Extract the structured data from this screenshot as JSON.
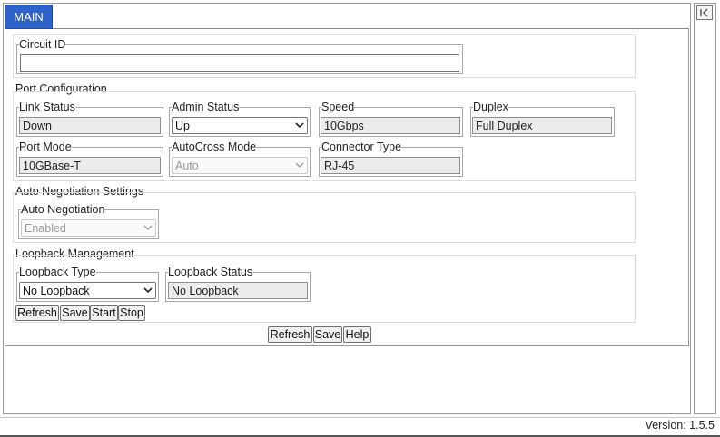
{
  "tabs": [
    {
      "label": "MAIN",
      "active": true
    }
  ],
  "collapse_icon": "collapse-left-icon",
  "circuit": {
    "legend": "Circuit ID",
    "value": "",
    "placeholder": ""
  },
  "port_config": {
    "title": "Port Configuration",
    "link_status": {
      "label": "Link Status",
      "value": "Down"
    },
    "admin_status": {
      "label": "Admin Status",
      "value": "Up"
    },
    "speed": {
      "label": "Speed",
      "value": "10Gbps"
    },
    "duplex": {
      "label": "Duplex",
      "value": "Full Duplex"
    },
    "port_mode": {
      "label": "Port Mode",
      "value": "10GBase-T"
    },
    "autocross": {
      "label": "AutoCross Mode",
      "value": "Auto",
      "disabled": true
    },
    "connector": {
      "label": "Connector Type",
      "value": "RJ-45"
    }
  },
  "auto_neg": {
    "title": "Auto Negotiation Settings",
    "field": {
      "label": "Auto Negotiation",
      "value": "Enabled",
      "disabled": true
    }
  },
  "loopback": {
    "title": "Loopback Management",
    "type": {
      "label": "Loopback Type",
      "value": "No Loopback"
    },
    "status": {
      "label": "Loopback Status",
      "value": "No Loopback"
    },
    "buttons": {
      "refresh": "Refresh",
      "save": "Save",
      "start": "Start",
      "stop": "Stop"
    }
  },
  "main_buttons": {
    "refresh": "Refresh",
    "save": "Save",
    "help": "Help"
  },
  "footer": {
    "version": "Version: 1.5.5"
  },
  "colors": {
    "tab_bg": "#2d63c8",
    "readonly_bg": "#ececec",
    "border": "#9a9a9a"
  }
}
